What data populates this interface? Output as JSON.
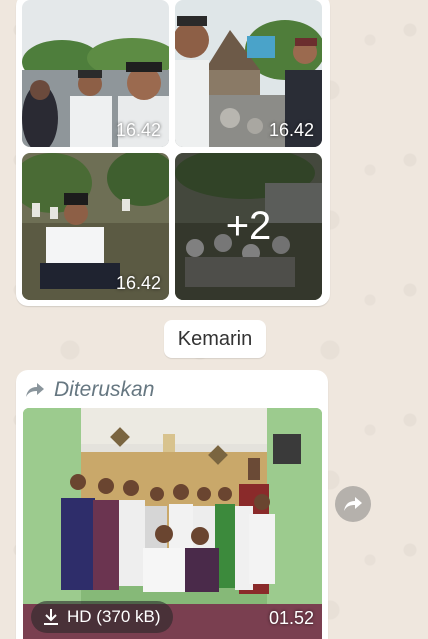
{
  "album": {
    "photos": [
      {
        "time": "16.42"
      },
      {
        "time": "16.42"
      },
      {
        "time": "16.42"
      },
      {
        "more_count": "+2"
      }
    ]
  },
  "date_separator": "Kemarin",
  "forwarded_message": {
    "label": "Diteruskan",
    "video": {
      "hd_label": "HD (370 kB)",
      "duration": "01.52"
    }
  },
  "icons": [
    "forwarded-arrow-icon",
    "download-icon",
    "share-forward-icon"
  ]
}
